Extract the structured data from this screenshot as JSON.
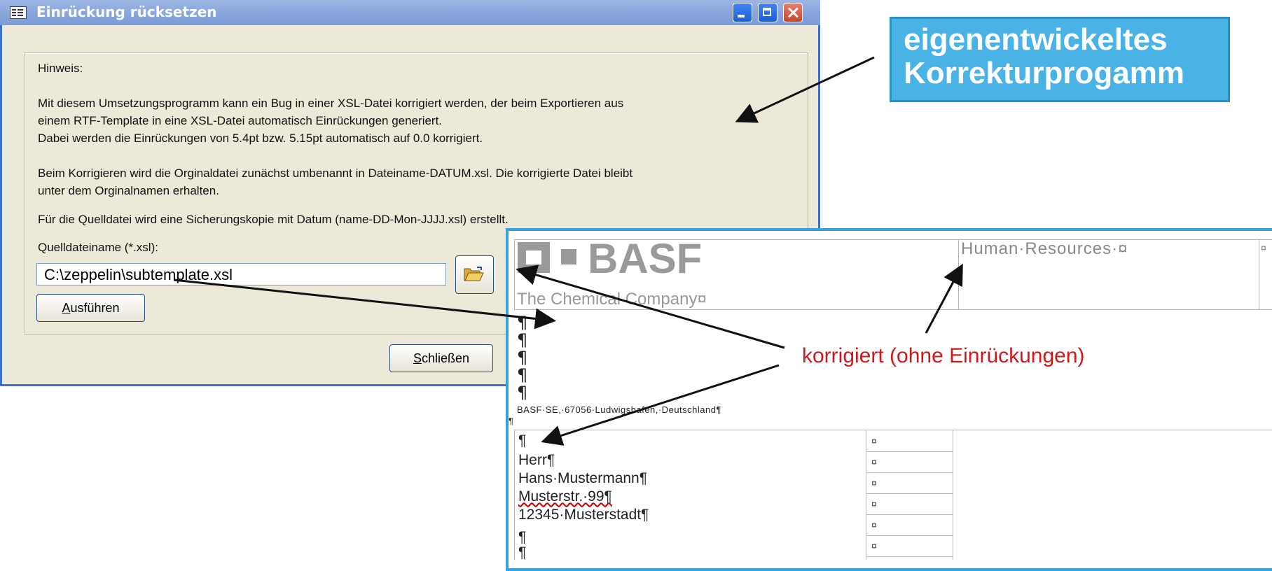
{
  "dialog": {
    "title": "Einrückung rücksetzen",
    "hint_label": "Hinweis:",
    "paragraph1_line1": "Mit diesem Umsetzungsprogramm kann ein Bug in einer XSL-Datei korrigiert werden, der beim Exportieren aus",
    "paragraph1_line2": "einem RTF-Template in eine XSL-Datei automatisch Einrückungen generiert.",
    "paragraph1_line3": "Dabei werden die Einrückungen von 5.4pt bzw. 5.15pt automatisch auf 0.0 korrigiert.",
    "paragraph2_line1": "Beim Korrigieren wird die Orginaldatei zunächst umbenannt in Dateiname-DATUM.xsl. Die korrigierte Datei bleibt",
    "paragraph2_line2": "unter dem Orginalnamen erhalten.",
    "paragraph3": "Für die Quelldatei wird eine Sicherungskopie mit Datum (name-DD-Mon-JJJJ.xsl) erstellt.",
    "source_label": "Quelldateiname (*.xsl):",
    "source_value": "C:\\zeppelin\\subtemplate.xsl",
    "run_button": "Ausführen",
    "close_button": "Schließen"
  },
  "callout": {
    "line1": "eigenentwickeltes",
    "line2": "Korrekturprogamm"
  },
  "document": {
    "logo_text": "BASF",
    "company": "The Chemical Company¤",
    "department": "Human·Resources·¤",
    "sender_line": "BASF·SE,·67056·Ludwigshafen,·Deutschland¶",
    "address_lines": [
      "¶",
      "Herr¶",
      "Hans·Mustermann¶",
      "Musterstr.·99¶",
      "12345·Musterstadt¶",
      "¶",
      "¶"
    ],
    "pilcrow": "¶",
    "cell_mark": "¤",
    "annotation": "korrigiert (ohne Einrückungen)"
  },
  "colors": {
    "callout_bg": "#4ab3e6",
    "annotation_red": "#cc1a1a",
    "titlebar": "#8aa6dc"
  }
}
